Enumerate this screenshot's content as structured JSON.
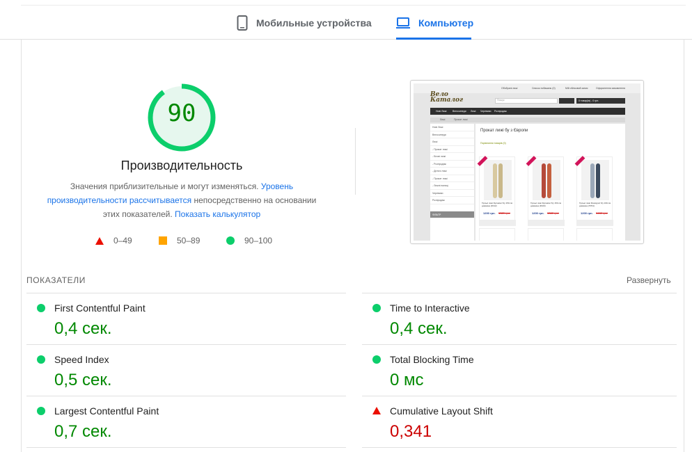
{
  "tabs": {
    "mobile_label": "Мобильные устройства",
    "desktop_label": "Компьютер"
  },
  "performance": {
    "score": "90",
    "score_fraction": 0.9,
    "title": "Производительность",
    "description_prefix": "Значения приблизительные и могут изменяться.",
    "description_link": "Уровень производительности рассчитывается",
    "description_middle": "непосредственно на основании этих показателей.",
    "calculator_link": "Показать калькулятор"
  },
  "legend": {
    "fail": "0–49",
    "average": "50–89",
    "pass": "90–100"
  },
  "colors": {
    "pass": "#0cce6b",
    "average": "#ffa400",
    "fail": "#eb0f00",
    "pass_text": "#008800",
    "fail_text": "#cc0000",
    "accent": "#1a73e8"
  },
  "thumbnail": {
    "logo": "Вело Каталог",
    "top_links": [
      "Обобрані лижі",
      "Список побажань (0)",
      "Мій обліковий запис",
      "Оформлення замовлення"
    ],
    "search_placeholder": "Пошук",
    "cart": "0 товар(ів) - 0 грн.",
    "nav": [
      "Нові Лижі",
      "Велосипеди",
      "Лижі",
      "Черевики",
      "Розпродаж"
    ],
    "breadcrumb": [
      "Лижі",
      "Прокат лижі"
    ],
    "sidebar": [
      "Нові Лижі",
      "Велосипеди",
      "Лижі",
      "- Прокат лижі",
      "- Бігові лижі",
      "- Розпродаж",
      "- Дитячі лижі",
      "- Прокат лижі",
      "- Лижні палиці",
      "Черевики",
      "Розпродаж"
    ],
    "filter": "ФІЛЬТР",
    "heading": "Прокат лижі бу з Європи",
    "subheading": "Порівняння товарів (0)",
    "products": [
      {
        "title": "Гірські лижі Dynastar б/у 150 см довжина (F012)",
        "price": "1200 грн.",
        "old": "1320 грн."
      },
      {
        "title": "Гірські лижі Dynastar б/у 150 см довжина (F023)",
        "price": "1200 грн.",
        "old": "1380 грн."
      },
      {
        "title": "Гірські лижі Rossignol б/у 160 см довжина (TP01)",
        "price": "1200 грн.",
        "old": "1460 грн."
      }
    ]
  },
  "metrics": {
    "section_label": "ПОКАЗАТЕЛИ",
    "expand_label": "Развернуть",
    "items": [
      {
        "name": "First Contentful Paint",
        "value": "0,4 сек.",
        "status": "pass"
      },
      {
        "name": "Time to Interactive",
        "value": "0,4 сек.",
        "status": "pass"
      },
      {
        "name": "Speed Index",
        "value": "0,5 сек.",
        "status": "pass"
      },
      {
        "name": "Total Blocking Time",
        "value": "0 мс",
        "status": "pass"
      },
      {
        "name": "Largest Contentful Paint",
        "value": "0,7 сек.",
        "status": "pass"
      },
      {
        "name": "Cumulative Layout Shift",
        "value": "0,341",
        "status": "fail"
      }
    ]
  }
}
